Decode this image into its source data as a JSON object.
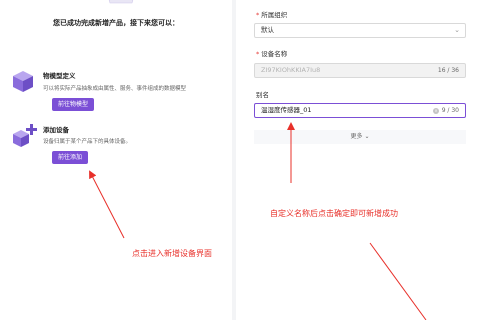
{
  "left_panel": {
    "success_message": "您已成功完成新增产品，接下来您可以：",
    "features": [
      {
        "icon": "cube-stack-icon",
        "title": "物模型定义",
        "description": "可以将实际产品抽象成由属性、服务、事件组成的数据模型",
        "button_label": "前往物模型"
      },
      {
        "icon": "add-device-icon",
        "title": "添加设备",
        "description": "设备归属于某个产品下的具体设备。",
        "button_label": "前往添加"
      }
    ]
  },
  "form": {
    "group": {
      "label": "所属组织",
      "value": "默认"
    },
    "device_name": {
      "label": "设备名称",
      "value": "ZI97KIOhKKIA7Iu8",
      "counter": "16 / 36"
    },
    "alias": {
      "label": "别名",
      "value": "温湿度传感器_01",
      "counter": "9 / 30"
    },
    "more_label": "更多"
  },
  "annotations": {
    "left": "点击进入新增设备界面",
    "right": "自定义名称后点击确定即可新增成功"
  },
  "colors": {
    "accent": "#7b4fd6",
    "annotation": "#e8302a",
    "disabled_bg": "#f2f2f2"
  }
}
